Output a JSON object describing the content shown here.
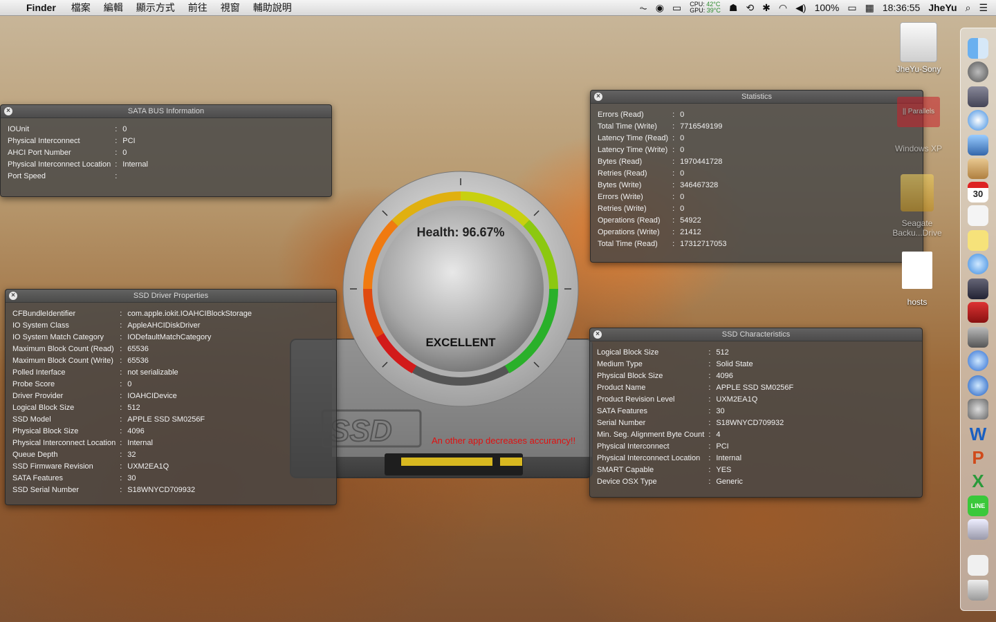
{
  "menubar": {
    "app_name": "Finder",
    "menus": [
      "檔案",
      "編輯",
      "顯示方式",
      "前往",
      "視窗",
      "輔助說明"
    ],
    "cpu_label": "CPU:",
    "cpu_temp": "42°C",
    "gpu_label": "GPU:",
    "gpu_temp": "39°C",
    "battery": "100%",
    "clock": "18:36:55",
    "user": "JheYu"
  },
  "sata_bus": {
    "title": "SATA BUS Information",
    "rows": [
      {
        "k": "IOUnit",
        "v": "0"
      },
      {
        "k": "Physical Interconnect",
        "v": "PCI"
      },
      {
        "k": "AHCI Port Number",
        "v": "0"
      },
      {
        "k": "Physical Interconnect Location",
        "v": "Internal"
      },
      {
        "k": "Port Speed",
        "v": ""
      }
    ]
  },
  "statistics": {
    "title": "Statistics",
    "rows": [
      {
        "k": "Errors (Read)",
        "v": "0"
      },
      {
        "k": "Total Time (Write)",
        "v": "7716549199"
      },
      {
        "k": "Latency Time (Read)",
        "v": "0"
      },
      {
        "k": "Latency Time (Write)",
        "v": "0"
      },
      {
        "k": "Bytes (Read)",
        "v": "1970441728"
      },
      {
        "k": "Retries (Read)",
        "v": "0"
      },
      {
        "k": "Bytes (Write)",
        "v": "346467328"
      },
      {
        "k": "Errors (Write)",
        "v": "0"
      },
      {
        "k": "Retries (Write)",
        "v": "0"
      },
      {
        "k": "Operations (Read)",
        "v": "54922"
      },
      {
        "k": "Operations (Write)",
        "v": "21412"
      },
      {
        "k": "Total Time (Read)",
        "v": "17312717053"
      }
    ]
  },
  "driver": {
    "title": "SSD Driver Properties",
    "rows": [
      {
        "k": "CFBundleIdentifier",
        "v": "com.apple.iokit.IOAHCIBlockStorage"
      },
      {
        "k": "IO System Class",
        "v": "AppleAHCIDiskDriver"
      },
      {
        "k": "IO System Match Category",
        "v": "IODefaultMatchCategory"
      },
      {
        "k": "Maximum Block Count (Read)",
        "v": "65536"
      },
      {
        "k": "Maximum Block Count (Write)",
        "v": "65536"
      },
      {
        "k": "Polled Interface",
        "v": "not serializable"
      },
      {
        "k": "Probe Score",
        "v": "0"
      },
      {
        "k": "Driver Provider",
        "v": "IOAHCIDevice"
      },
      {
        "k": "Logical Block Size",
        "v": "512"
      },
      {
        "k": "SSD Model",
        "v": "APPLE SSD SM0256F"
      },
      {
        "k": "Physical Block Size",
        "v": "4096"
      },
      {
        "k": "Physical Interconnect Location",
        "v": "Internal"
      },
      {
        "k": "Queue Depth",
        "v": "32"
      },
      {
        "k": "SSD Firmware Revision",
        "v": "UXM2EA1Q"
      },
      {
        "k": "SATA Features",
        "v": "30"
      },
      {
        "k": "SSD Serial Number",
        "v": "S18WNYCD709932"
      }
    ]
  },
  "characteristics": {
    "title": "SSD Characteristics",
    "rows": [
      {
        "k": "Logical Block Size",
        "v": "512"
      },
      {
        "k": "Medium Type",
        "v": "Solid State"
      },
      {
        "k": "Physical Block Size",
        "v": "4096"
      },
      {
        "k": "Product Name",
        "v": "APPLE SSD SM0256F"
      },
      {
        "k": "Product Revision Level",
        "v": "UXM2EA1Q"
      },
      {
        "k": "SATA Features",
        "v": "30"
      },
      {
        "k": "Serial Number",
        "v": "S18WNYCD709932"
      },
      {
        "k": "Min. Seg. Alignment Byte Count",
        "v": "4"
      },
      {
        "k": "Physical Interconnect",
        "v": "PCI"
      },
      {
        "k": "Physical Interconnect Location",
        "v": "Internal"
      },
      {
        "k": "SMART Capable",
        "v": "YES"
      },
      {
        "k": "Device OSX Type",
        "v": "Generic"
      }
    ]
  },
  "gauge": {
    "health_text": "Health: 96.67%",
    "health_value_percent": 96.67,
    "rating": "EXCELLENT",
    "ssd_label": "SSD",
    "warning": "An other app decreases accurancy!!"
  },
  "desktop_icons": {
    "drive": "JheYu-Sony",
    "parallels_brand": "|| Parallels",
    "windows_vm": "Windows XP",
    "seagate_line1": "Seagate",
    "seagate_line2": "Backu...Drive",
    "hosts": "hosts"
  },
  "dock": {
    "items": [
      "finder-icon",
      "launchpad-icon",
      "photo-browser-icon",
      "safari-icon",
      "preview-icon",
      "contacts-icon",
      "calendar-icon",
      "textedit-icon",
      "stickies-icon",
      "messages-icon",
      "facetime-icon",
      "photo-booth-icon",
      "image-capture-icon",
      "itunes-icon",
      "app-store-icon",
      "system-preferences-icon",
      "word-icon",
      "powerpoint-icon",
      "excel-icon",
      "line-icon",
      "network-icon",
      "document-icon",
      "trash-icon"
    ],
    "calendar_day": "30",
    "word_letter": "W",
    "powerpoint_letter": "P",
    "excel_letter": "X",
    "line_label": "LINE"
  }
}
